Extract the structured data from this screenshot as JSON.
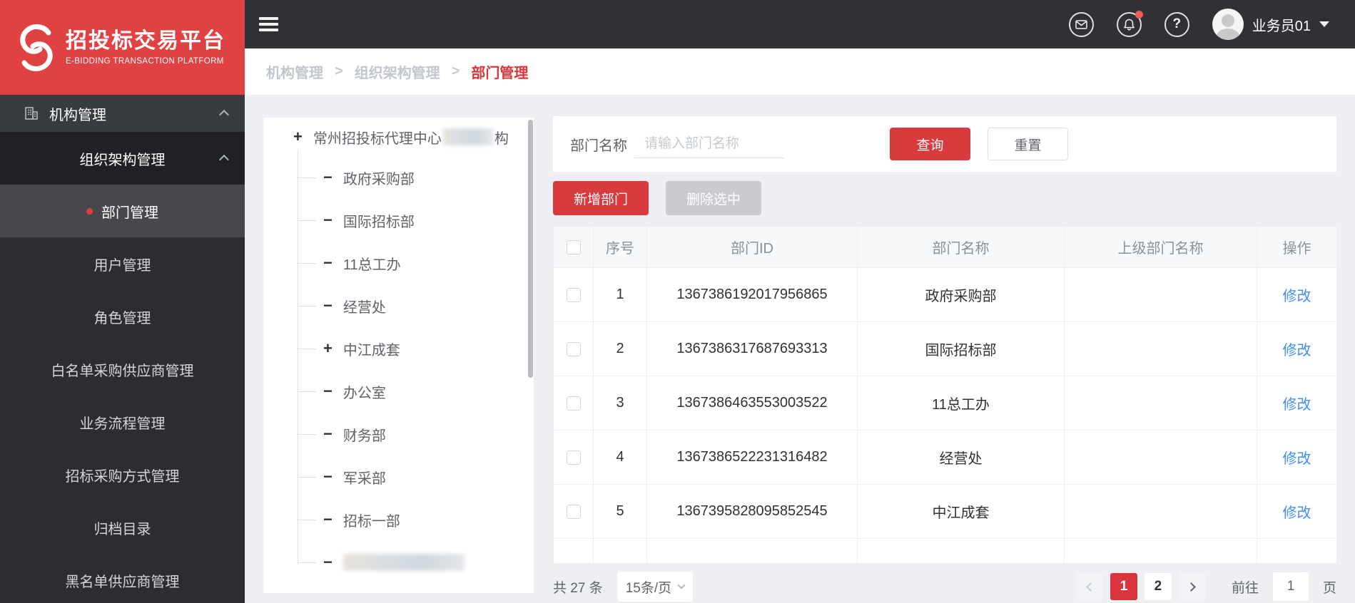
{
  "colors": {
    "brand_red": "#e04143",
    "button_red": "#d93a3e",
    "link_blue": "#3f8ff6"
  },
  "brand": {
    "title": "招投标交易平台",
    "subtitle": "E-BIDDING TRANSACTION PLATFORM"
  },
  "topbar": {
    "user": "业务员01",
    "help_glyph": "?"
  },
  "breadcrumb": {
    "items": [
      "机构管理",
      "组织架构管理",
      "部门管理"
    ],
    "separator": ">"
  },
  "sidebar": {
    "items": [
      {
        "id": "org-mgmt",
        "label": "机构管理",
        "type": "top",
        "icon": "building-icon",
        "caret": true
      },
      {
        "id": "org-structure-mgmt",
        "label": "组织架构管理",
        "type": "group",
        "caret": true
      },
      {
        "id": "dept-mgmt",
        "label": "部门管理",
        "type": "child",
        "active": true
      },
      {
        "id": "user-mgmt",
        "label": "用户管理",
        "type": "child"
      },
      {
        "id": "role-mgmt",
        "label": "角色管理",
        "type": "child"
      },
      {
        "id": "whitelist-supplier-mgmt",
        "label": "白名单采购供应商管理",
        "type": "child"
      },
      {
        "id": "business-flow-mgmt",
        "label": "业务流程管理",
        "type": "child"
      },
      {
        "id": "bid-method-mgmt",
        "label": "招标采购方式管理",
        "type": "child"
      },
      {
        "id": "archive-catalog",
        "label": "归档目录",
        "type": "child"
      },
      {
        "id": "blacklist-supplier-mgmt",
        "label": "黑名单供应商管理",
        "type": "child"
      }
    ]
  },
  "tree": {
    "root": {
      "toggle": "+",
      "label": "常州招投标代理中心",
      "suffix": "构",
      "redacted_middle": true
    },
    "nodes": [
      {
        "toggle": "−",
        "label": "政府采购部"
      },
      {
        "toggle": "−",
        "label": "国际招标部"
      },
      {
        "toggle": "−",
        "label": "11总工办"
      },
      {
        "toggle": "−",
        "label": "经营处"
      },
      {
        "toggle": "+",
        "label": "中江成套"
      },
      {
        "toggle": "−",
        "label": "办公室"
      },
      {
        "toggle": "−",
        "label": "财务部"
      },
      {
        "toggle": "−",
        "label": "军采部"
      },
      {
        "toggle": "−",
        "label": "招标一部"
      },
      {
        "toggle": "−",
        "label": "",
        "redacted": true
      }
    ]
  },
  "filter": {
    "label": "部门名称",
    "placeholder": "请输入部门名称",
    "search_label": "查询",
    "reset_label": "重置"
  },
  "actions": {
    "add_label": "新增部门",
    "delete_label": "删除选中"
  },
  "table": {
    "headers": [
      "序号",
      "部门ID",
      "部门名称",
      "上级部门名称",
      "操作"
    ],
    "rows": [
      {
        "no": "1",
        "id": "1367386192017956865",
        "name": "政府采购部",
        "parent": "",
        "action": "修改"
      },
      {
        "no": "2",
        "id": "1367386317687693313",
        "name": "国际招标部",
        "parent": "",
        "action": "修改"
      },
      {
        "no": "3",
        "id": "1367386463553003522",
        "name": "11总工办",
        "parent": "",
        "action": "修改"
      },
      {
        "no": "4",
        "id": "1367386522231316482",
        "name": "经营处",
        "parent": "",
        "action": "修改"
      },
      {
        "no": "5",
        "id": "1367395828095852545",
        "name": "中江成套",
        "parent": "",
        "action": "修改"
      }
    ]
  },
  "pagination": {
    "total_text": "共 27 条",
    "page_size": "15条/页",
    "pages": [
      {
        "label": "1",
        "active": true
      },
      {
        "label": "2",
        "active": false
      }
    ],
    "goto_label": "前往",
    "goto_value": "1",
    "page_unit": "页"
  }
}
